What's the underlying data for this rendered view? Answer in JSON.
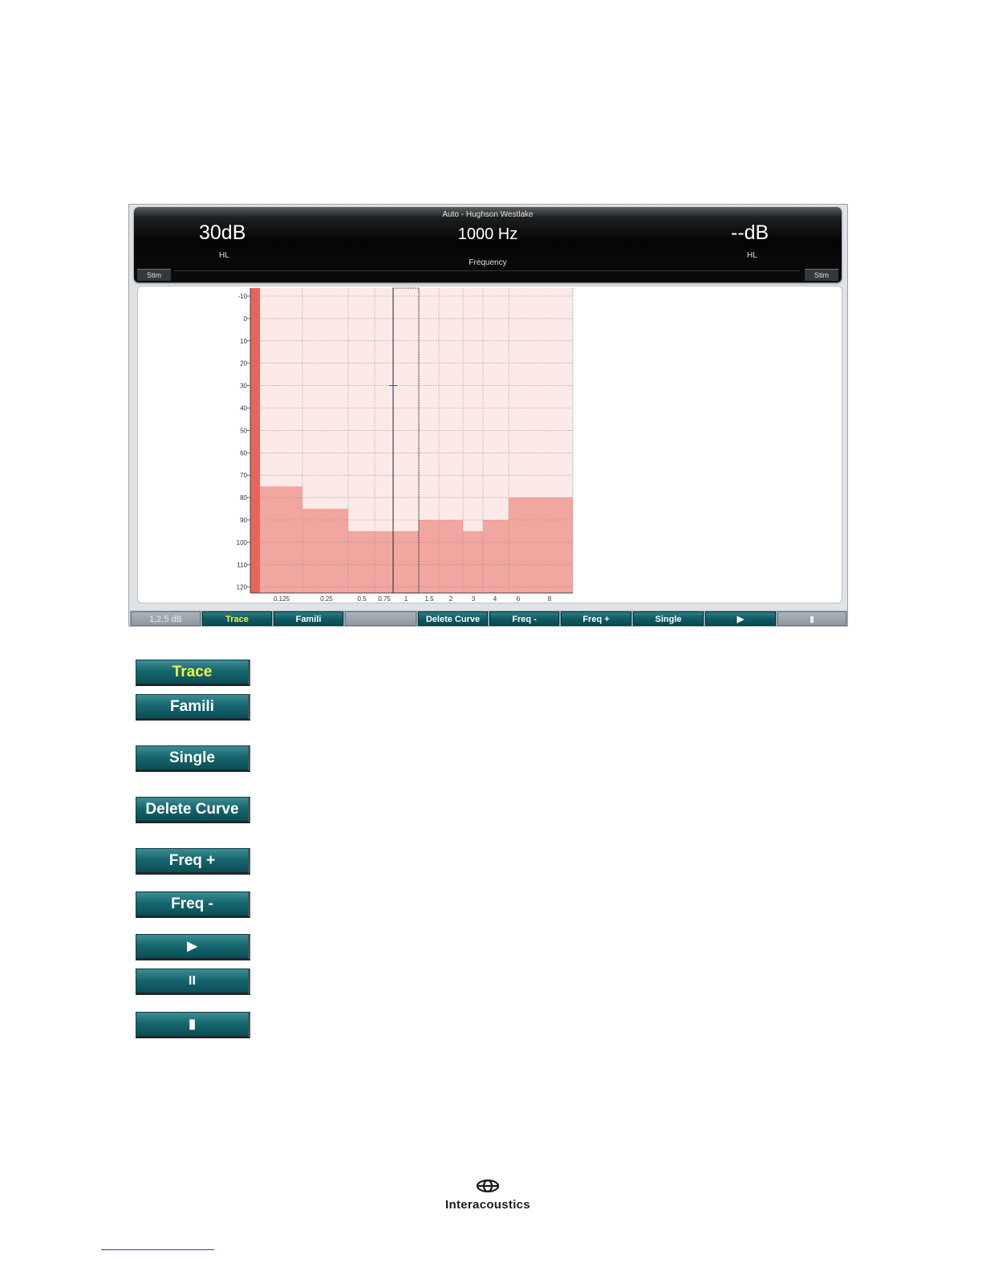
{
  "screen": {
    "header": {
      "protocol": "Auto - Hughson Westlake",
      "left_level": "30dB",
      "left_unit": "HL",
      "frequency": "1000 Hz",
      "frequency_label": "Frequency",
      "right_level": "--dB",
      "right_unit": "HL",
      "stim_left": "Stim",
      "stim_right": "Stim"
    },
    "audiogram": {
      "y_ticks": [
        "-10",
        "0",
        "10",
        "20",
        "30",
        "40",
        "50",
        "60",
        "70",
        "80",
        "90",
        "100",
        "110",
        "120"
      ],
      "x_ticks": [
        "0.125",
        "0.25",
        "0.5",
        "0.75",
        "1",
        "1.5",
        "2",
        "3",
        "4",
        "6",
        "8"
      ],
      "cursor": {
        "frequency": "1",
        "level_db": 30
      },
      "shaded_limits": [
        {
          "freq": "0.125",
          "level_db": 75
        },
        {
          "freq": "0.25",
          "level_db": 85
        },
        {
          "freq": "0.5",
          "level_db": 95
        },
        {
          "freq": "0.75",
          "level_db": 95
        },
        {
          "freq": "1",
          "level_db": 95
        },
        {
          "freq": "1.5",
          "level_db": 90
        },
        {
          "freq": "2",
          "level_db": 90
        },
        {
          "freq": "3",
          "level_db": 95
        },
        {
          "freq": "4",
          "level_db": 90
        },
        {
          "freq": "6",
          "level_db": 80
        },
        {
          "freq": "8",
          "level_db": 80
        }
      ],
      "colors": {
        "max_fill": "#f2a6a0",
        "bg_fill": "#fbe1df",
        "marker": "#e8645a"
      }
    },
    "fkeys": {
      "step": "1,2,5 dB",
      "trace": "Trace",
      "famili": "Famili",
      "blank": "",
      "delete_curve": "Delete Curve",
      "freq_minus": "Freq -",
      "freq_plus": "Freq +",
      "single": "Single",
      "play": "▶",
      "stop": "▮"
    }
  },
  "buttons": {
    "trace": "Trace",
    "famili": "Famili",
    "single": "Single",
    "delete_curve": "Delete Curve",
    "freq_plus": "Freq +",
    "freq_minus": "Freq -",
    "play": "▶",
    "pause": "II",
    "stop": "▮"
  },
  "footer": {
    "brand": "Interacoustics"
  }
}
